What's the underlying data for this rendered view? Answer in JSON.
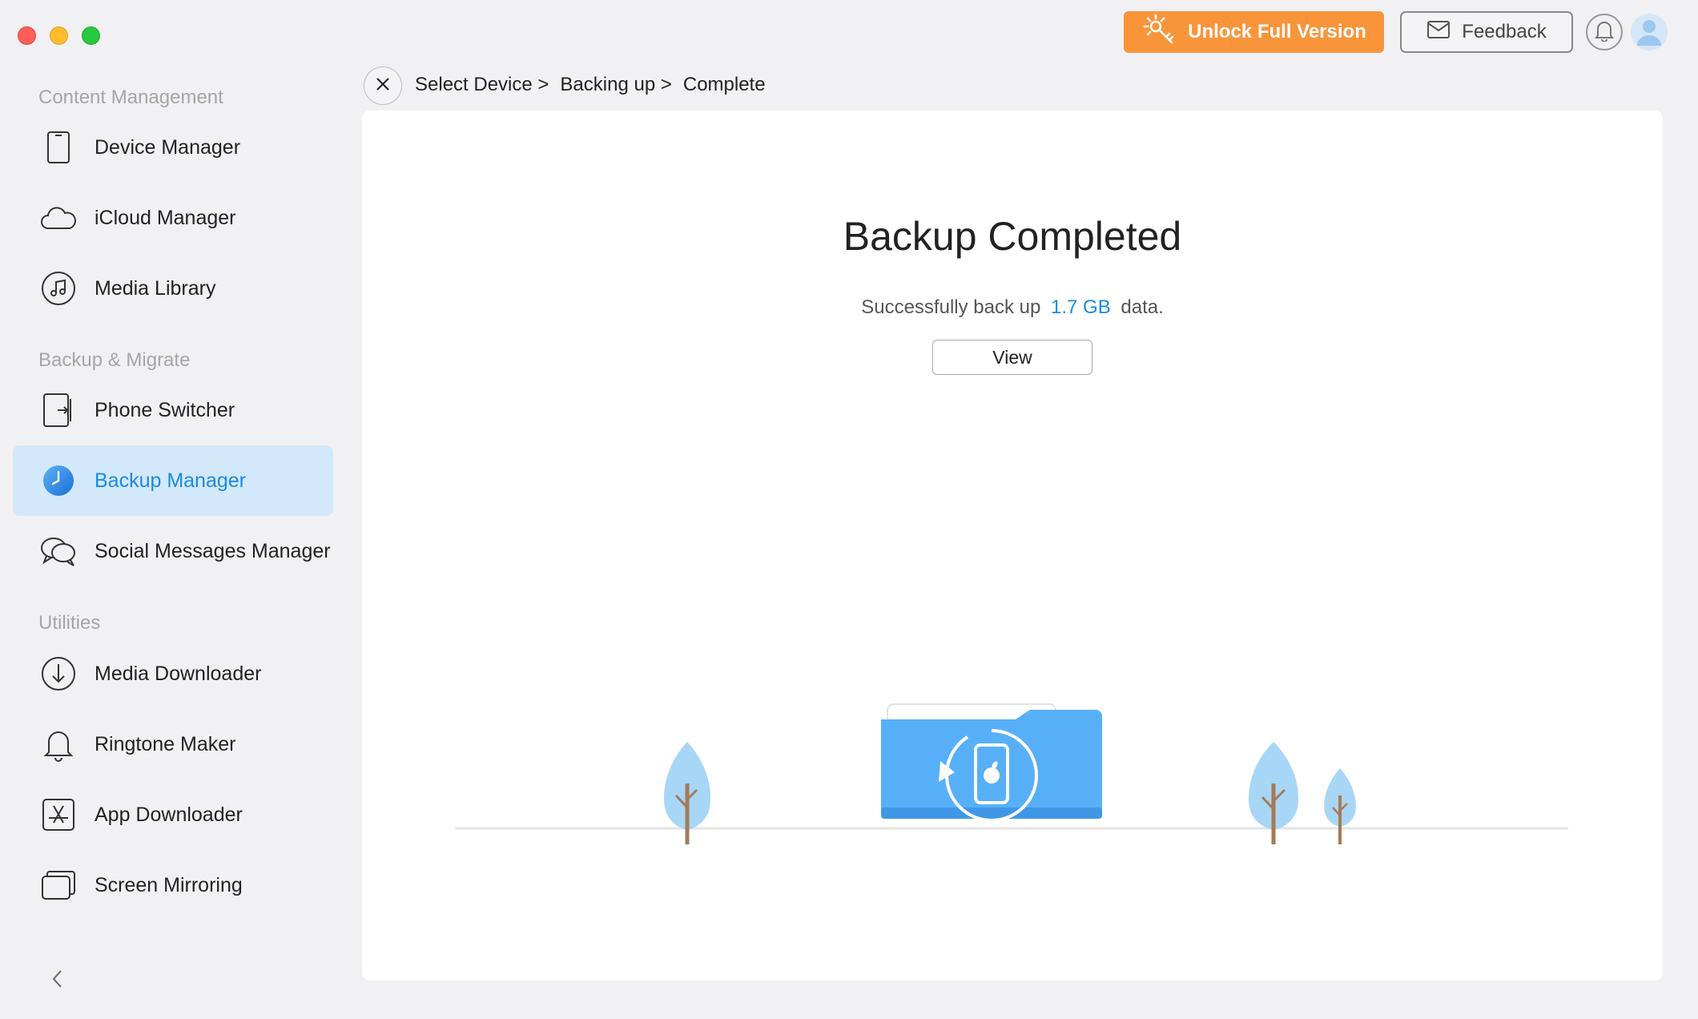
{
  "header": {
    "unlock_label": "Unlock Full Version",
    "feedback_label": "Feedback",
    "accent_color": "#f8953a"
  },
  "sidebar": {
    "sections": [
      {
        "label": "Content Management"
      },
      {
        "label": "Backup & Migrate"
      },
      {
        "label": "Utilities"
      }
    ],
    "items": [
      {
        "label": "Device Manager",
        "icon": "phone-icon"
      },
      {
        "label": "iCloud Manager",
        "icon": "cloud-icon"
      },
      {
        "label": "Media Library",
        "icon": "music-icon"
      },
      {
        "label": "Phone Switcher",
        "icon": "phone-switch-icon"
      },
      {
        "label": "Backup Manager",
        "icon": "backup-clock-icon",
        "active": true
      },
      {
        "label": "Social Messages Manager",
        "icon": "chat-bubbles-icon"
      },
      {
        "label": "Media Downloader",
        "icon": "download-arrow-icon"
      },
      {
        "label": "Ringtone Maker",
        "icon": "bell-icon"
      },
      {
        "label": "App Downloader",
        "icon": "app-store-icon"
      },
      {
        "label": "Screen Mirroring",
        "icon": "screens-icon"
      }
    ]
  },
  "breadcrumb": {
    "step1": "Select Device >",
    "step2": "Backing up >",
    "step3": "Complete"
  },
  "main": {
    "title": "Backup Completed",
    "subtitle_prefix": "Successfully back up",
    "amount": "1.7 GB",
    "subtitle_suffix": "data.",
    "view_label": "View",
    "highlight_color": "#1b8be0"
  }
}
